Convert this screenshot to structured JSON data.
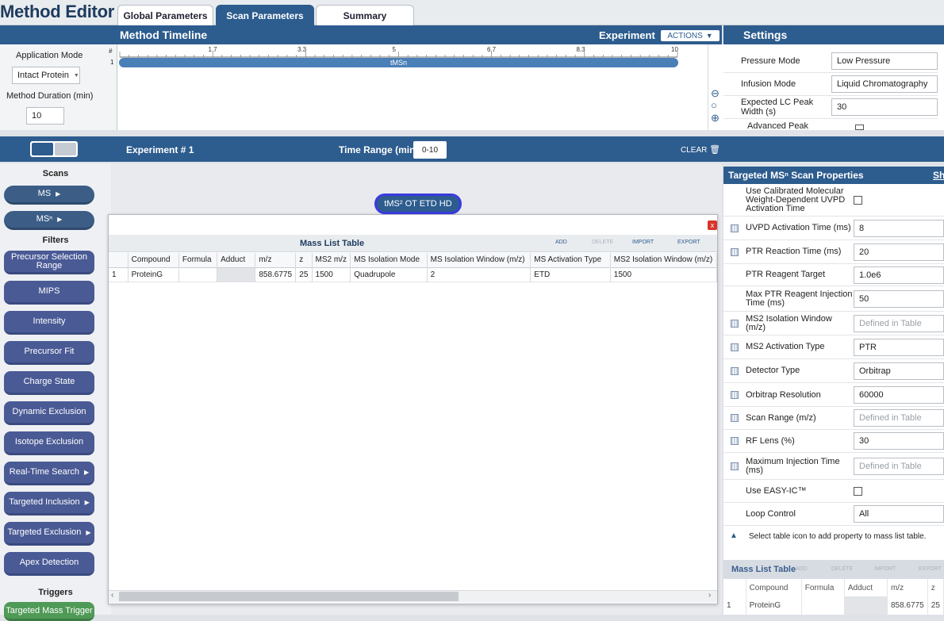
{
  "app": {
    "title": "Method Editor"
  },
  "tabs": [
    {
      "label": "Global Parameters"
    },
    {
      "label": "Scan Parameters"
    },
    {
      "label": "Summary"
    }
  ],
  "timeline": {
    "title": "Method Timeline",
    "experiment_label": "Experiment",
    "actions_label": "ACTIONS",
    "ticks": [
      "1.7",
      "3.3",
      "5",
      "6.7",
      "8.3",
      "10"
    ],
    "row_header": "#",
    "row_number": "1",
    "scan_pill": "tMSn"
  },
  "left_panel": {
    "app_mode_label": "Application Mode",
    "app_mode_value": "Intact Protein",
    "duration_label": "Method Duration (min)",
    "duration_value": "10"
  },
  "settings": {
    "title": "Settings",
    "rows": [
      {
        "label": "Pressure Mode",
        "value": "Low Pressure"
      },
      {
        "label": "Infusion Mode",
        "value": "Liquid Chromatography"
      },
      {
        "label": "Expected LC Peak Width (s)",
        "value": "30"
      },
      {
        "label": "Advanced Peak",
        "value": ""
      }
    ]
  },
  "experiment": {
    "number_label": "Experiment # 1",
    "time_range_label": "Time Range (min)",
    "time_range_value": "0-10",
    "clear_label": "CLEAR"
  },
  "sidebar": {
    "scans_header": "Scans",
    "scans": [
      {
        "label": "MS"
      },
      {
        "label": "MSⁿ"
      }
    ],
    "filters_header": "Filters",
    "filters": [
      {
        "label": "Precursor Selection Range",
        "arrow": false
      },
      {
        "label": "MIPS",
        "arrow": false
      },
      {
        "label": "Intensity",
        "arrow": false
      },
      {
        "label": "Precursor Fit",
        "arrow": false
      },
      {
        "label": "Charge State",
        "arrow": false
      },
      {
        "label": "Dynamic Exclusion",
        "arrow": false
      },
      {
        "label": "Isotope Exclusion",
        "arrow": false
      },
      {
        "label": "Real-Time Search",
        "arrow": true
      },
      {
        "label": "Targeted Inclusion",
        "arrow": true
      },
      {
        "label": "Targeted Exclusion",
        "arrow": true
      },
      {
        "label": "Apex Detection",
        "arrow": false
      }
    ],
    "triggers_header": "Triggers",
    "triggers": [
      {
        "label": "Targeted Mass Trigger"
      }
    ]
  },
  "canvas": {
    "scan_node_label": "tMS² OT ETD HD"
  },
  "mass_list_modal": {
    "title": "Mass List Table",
    "actions": [
      "ADD",
      "DELETE",
      "IMPORT",
      "EXPORT"
    ],
    "close_label": "x",
    "columns": [
      "",
      "Compound",
      "Formula",
      "Adduct",
      "m/z",
      "z",
      "MS2 m/z",
      "MS Isolation Mode",
      "MS Isolation Window (m/z)",
      "MS Activation Type",
      "MS2 Isolation Window (m/z)"
    ],
    "rows": [
      [
        "1",
        "ProteinG",
        "",
        "",
        "858.6775",
        "25",
        "1500",
        "Quadrupole",
        "2",
        "ETD",
        "1500"
      ]
    ]
  },
  "properties": {
    "title": "Targeted MSⁿ Scan Properties",
    "show_label": "Sh",
    "rows": [
      {
        "label": "Use Calibrated Molecular Weight-Dependent UVPD Activation Time",
        "type": "check",
        "value": "",
        "icon": false
      },
      {
        "label": "UVPD Activation Time (ms)",
        "type": "text",
        "value": "8",
        "icon": true
      },
      {
        "label": "PTR Reaction Time (ms)",
        "type": "text",
        "value": "20",
        "icon": true
      },
      {
        "label": "PTR Reagent Target",
        "type": "text",
        "value": "1.0e6",
        "icon": false
      },
      {
        "label": "Max PTR Reagent Injection Time (ms)",
        "type": "text",
        "value": "50",
        "icon": false
      },
      {
        "label": "MS2 Isolation Window (m/z)",
        "type": "placeholder",
        "value": "Defined in Table",
        "icon": true
      },
      {
        "label": "MS2 Activation Type",
        "type": "text",
        "value": "PTR",
        "icon": true
      },
      {
        "label": "Detector Type",
        "type": "text",
        "value": "Orbitrap",
        "icon": true
      },
      {
        "label": "Orbitrap Resolution",
        "type": "text",
        "value": "60000",
        "icon": true
      },
      {
        "label": "Scan Range (m/z)",
        "type": "placeholder",
        "value": "Defined in Table",
        "icon": true
      },
      {
        "label": "RF Lens (%)",
        "type": "text",
        "value": "30",
        "icon": true
      },
      {
        "label": "Maximum Injection Time (ms)",
        "type": "placeholder",
        "value": "Defined in Table",
        "icon": true
      },
      {
        "label": "Use EASY-IC™",
        "type": "check",
        "value": "",
        "icon": false
      },
      {
        "label": "Loop Control",
        "type": "text",
        "value": "All",
        "icon": false
      }
    ],
    "hint": "Select table icon to add property to mass list table."
  },
  "mini_mass_list": {
    "title": "Mass List Table",
    "actions": [
      "ADD",
      "DELETE",
      "IMPORT",
      "EXPORT"
    ],
    "columns": [
      "",
      "Compound",
      "Formula",
      "Adduct",
      "m/z",
      "z"
    ],
    "rows": [
      [
        "1",
        "ProteinG",
        "",
        "",
        "858.6775",
        "25"
      ]
    ]
  },
  "colors": {
    "brand": "#2d5c8e",
    "filter_button": "#4a5a95",
    "trigger_button": "#4f9a56",
    "close_button": "#d9342b"
  }
}
